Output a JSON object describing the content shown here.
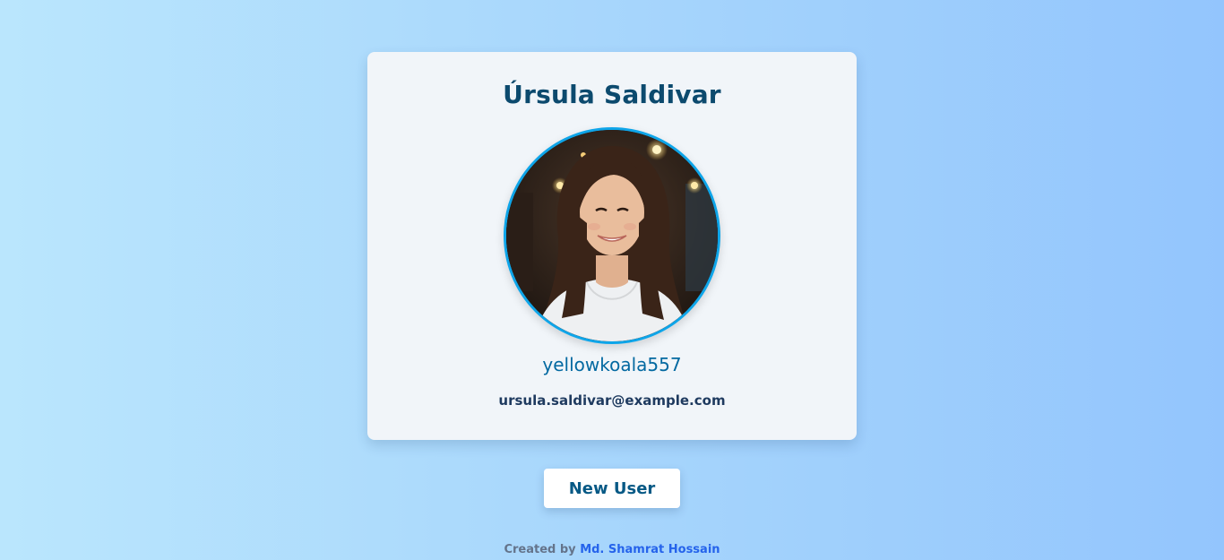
{
  "profile": {
    "name": "Úrsula Saldivar",
    "username": "yellowkoala557",
    "email": "ursula.saldivar@example.com",
    "avatar_alt": "Úrsula Saldivar"
  },
  "actions": {
    "new_user_label": "New User"
  },
  "footer": {
    "prefix": "Created by",
    "author": "Md. Shamrat Hossain"
  },
  "colors": {
    "accent": "#0ea5e9",
    "name_text": "#0c4a6e",
    "username_text": "#0369a1",
    "link": "#2563eb"
  }
}
